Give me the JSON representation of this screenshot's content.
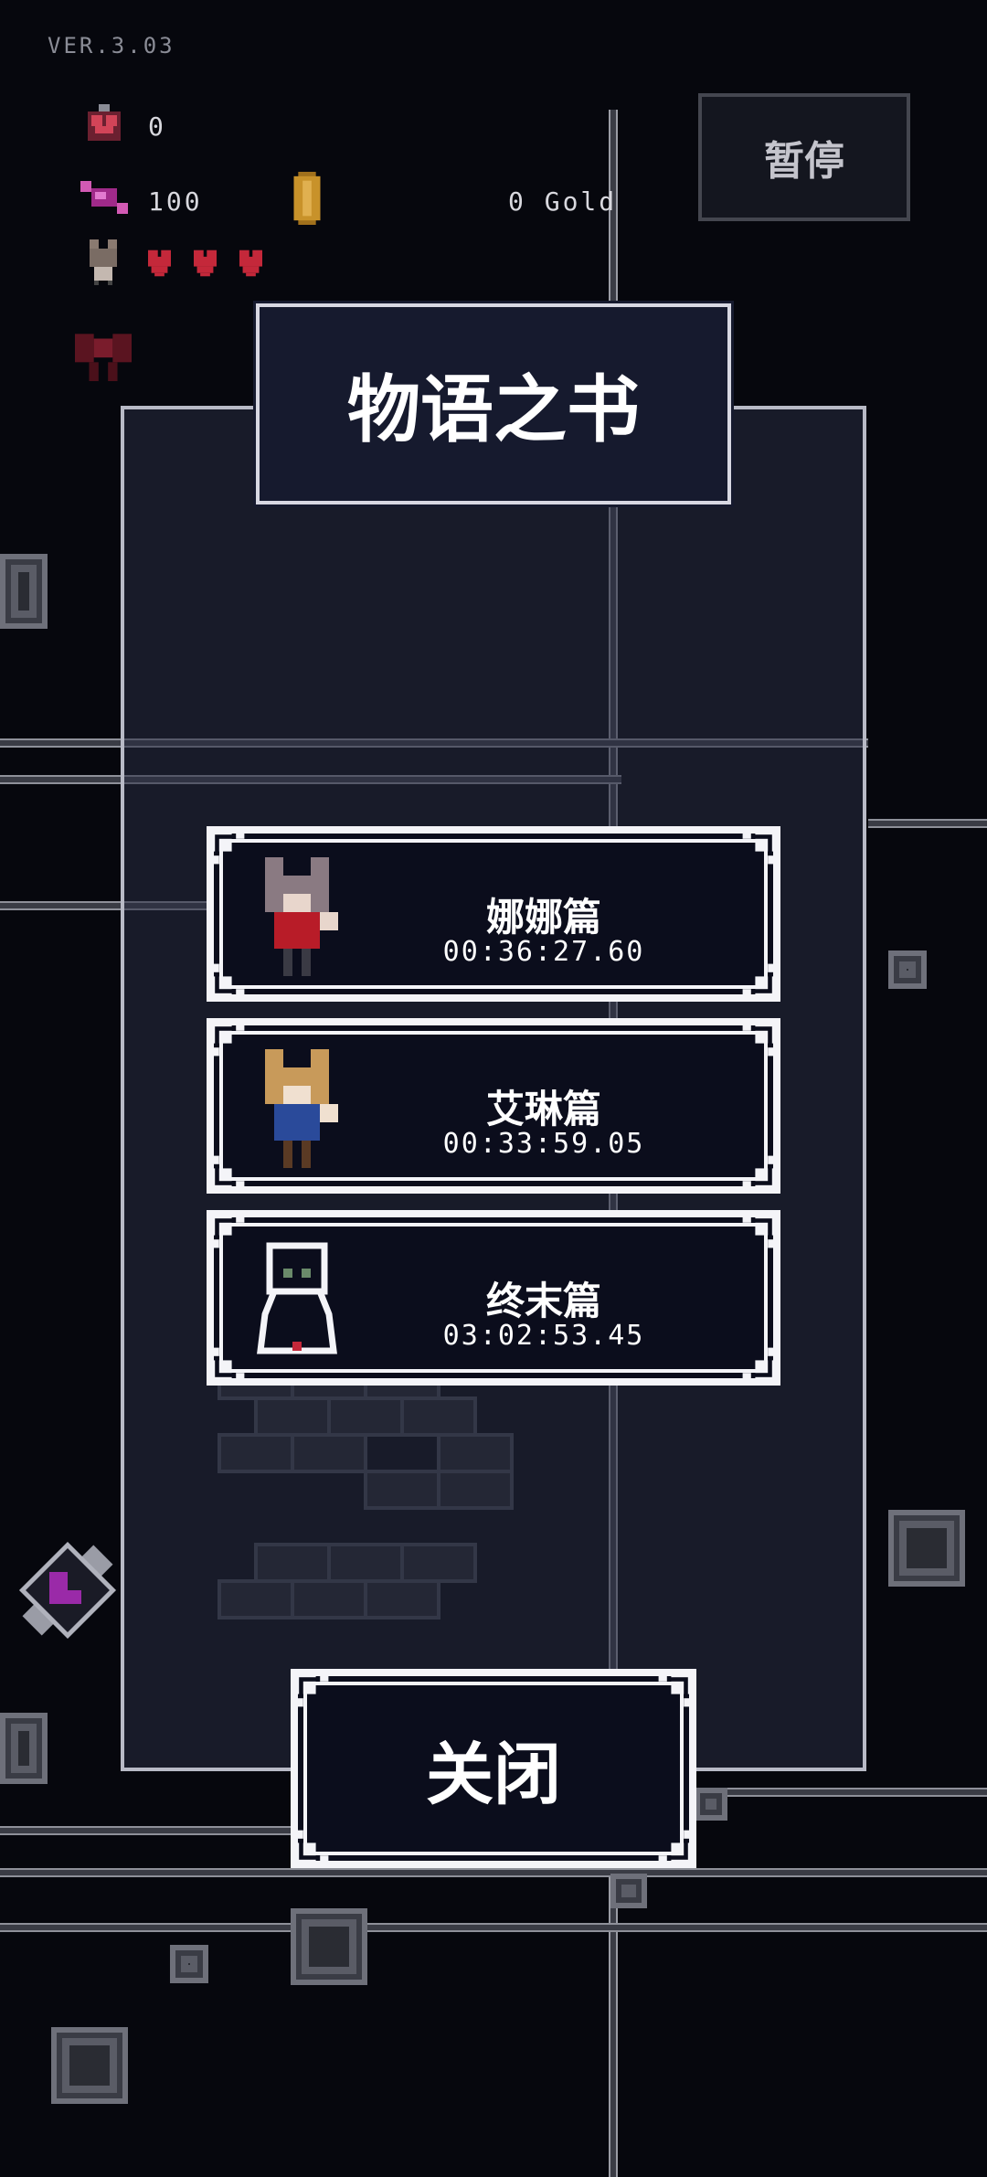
{
  "hud": {
    "version": "VER.3.03",
    "potions": "0",
    "candy": "100",
    "gold": "0 Gold",
    "pause_label": "暂停"
  },
  "book": {
    "title": "物语之书",
    "chapters": [
      {
        "name": "娜娜篇",
        "time": "00:36:27.60"
      },
      {
        "name": "艾琳篇",
        "time": "00:33:59.05"
      },
      {
        "name": "终末篇",
        "time": "03:02:53.45"
      }
    ],
    "close_label": "关闭"
  },
  "colors": {
    "background": "#06070d",
    "panel": "#282c42",
    "card": "#0b0d1c",
    "heart": "#c4283a",
    "gold": "#c8922a",
    "candy": "#b0308c"
  },
  "icons": [
    "potion-icon",
    "candy-icon",
    "gold-coin-icon",
    "character-icon",
    "heart-icon",
    "bow-icon",
    "boot-icon"
  ]
}
